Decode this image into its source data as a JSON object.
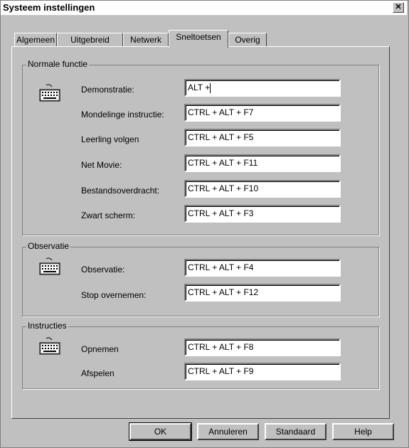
{
  "window": {
    "title": "Systeem instellingen",
    "close_glyph": "✕"
  },
  "tabs": [
    {
      "label": "Algemeen"
    },
    {
      "label": "Uitgebreid"
    },
    {
      "label": "Netwerk"
    },
    {
      "label": "Sneltoetsen",
      "active": true
    },
    {
      "label": "Overig"
    }
  ],
  "groups": {
    "normal": {
      "title": "Normale functie",
      "rows": [
        {
          "label": "Demonstratie:",
          "value": "ALT +"
        },
        {
          "label": "Mondelinge instructie:",
          "value": "CTRL + ALT + F7"
        },
        {
          "label": "Leerling volgen",
          "value": "CTRL + ALT + F5"
        },
        {
          "label": "Net Movie:",
          "value": "CTRL + ALT + F11"
        },
        {
          "label": "Bestandsoverdracht:",
          "value": "CTRL + ALT + F10"
        },
        {
          "label": "Zwart scherm:",
          "value": "CTRL + ALT + F3"
        }
      ]
    },
    "observation": {
      "title": "Observatie",
      "rows": [
        {
          "label": "Observatie:",
          "value": "CTRL + ALT + F4"
        },
        {
          "label": "Stop overnemen:",
          "value": "CTRL + ALT + F12"
        }
      ]
    },
    "instructions": {
      "title": "Instructies",
      "rows": [
        {
          "label": "Opnemen",
          "value": "CTRL + ALT + F8"
        },
        {
          "label": "Afspelen",
          "value": "CTRL + ALT + F9"
        }
      ]
    }
  },
  "icons": {
    "group_icon": "keyboard-icon"
  },
  "buttons": {
    "ok": "OK",
    "cancel": "Annuleren",
    "default": "Standaard",
    "help": "Help"
  }
}
